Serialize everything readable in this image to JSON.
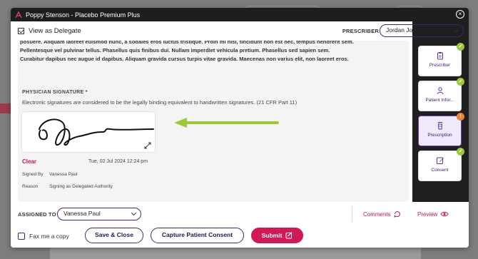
{
  "window": {
    "title": "Poppy Stenson - Placebo Premium Plus"
  },
  "delegate": {
    "label": "View as Delegate",
    "checked": true
  },
  "prescriber": {
    "label": "PRESCRIBER",
    "value": "Jordan  John"
  },
  "body_text": {
    "line1": "posuere. Aliquam laoreet euismod nunc, a sodales eros luctus tristique. Proin mi nisi, tincidunt non est nec, tempus hendrerit sem.",
    "line2": "Pellentesque vel pulvinar tellus. Phasellus quis finibus dui. Nullam imperdiet vehicula pretium. Phasellus sed sapien sem.",
    "line3": "Curabitur dapibus nec augue id dapibus. Aliquam gravida cursus turpis vitae gravida. Maecenas non varius elit, non laoreet eros."
  },
  "signature": {
    "title": "PHYSICIAN SIGNATURE *",
    "note": "Electronic signatures are considered to be the legally binding equivalent to handwritten signatures. (21 CFR Part 11)",
    "clear_label": "Clear",
    "date": "Tue, 02 Jul 2024 12:24 pm",
    "signed_by_label": "Signed By",
    "signed_by_value": "Vanessa Paul",
    "reason_label": "Reason",
    "reason_value": "Signing as Delegated Authority"
  },
  "steps": [
    {
      "label": "Prescriber",
      "status": "complete",
      "icon": "clipboard-icon",
      "badge": "✓"
    },
    {
      "label": "Patient Infor...",
      "status": "complete",
      "icon": "person-icon",
      "badge": "✓"
    },
    {
      "label": "Prescription",
      "status": "warning",
      "icon": "cup-icon",
      "badge": "!"
    },
    {
      "label": "Consent",
      "status": "complete",
      "icon": "edit-icon",
      "badge": "✓"
    }
  ],
  "footer": {
    "assigned_label": "ASSIGNED TO",
    "assigned_value": "Vanessa  Paul",
    "comments_label": "Comments",
    "preview_label": "Preview",
    "fax_label": "Fax me a copy",
    "save_close_label": "Save & Close",
    "capture_label": "Capture Patient Consent",
    "submit_label": "Submit"
  },
  "colors": {
    "brand_purple": "#4a2370",
    "accent_pink": "#d01958",
    "annotation_green": "#9cc93c",
    "warning_orange": "#f0813a"
  }
}
